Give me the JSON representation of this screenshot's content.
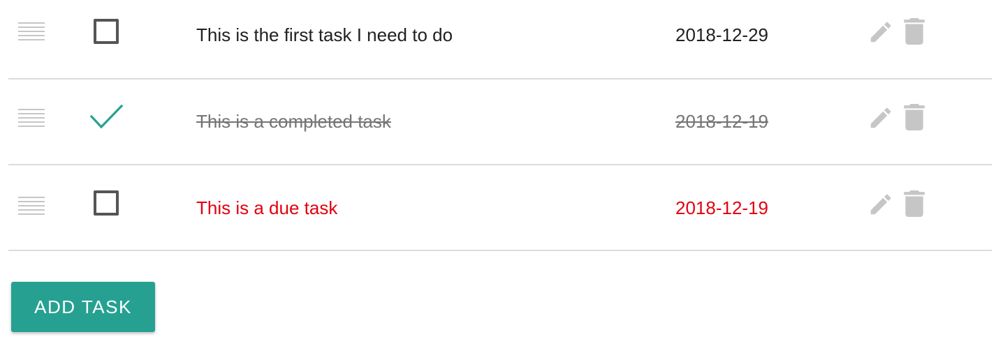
{
  "colors": {
    "accent": "#26a191",
    "due": "#e3000f",
    "completed": "#757575",
    "icon": "#c6c6c6"
  },
  "tasks": [
    {
      "title": "This is the first task I need to do",
      "date": "2018-12-29",
      "status": "open",
      "checked": false,
      "drag_icon": "drag-handle-icon",
      "edit_icon": "pencil-icon",
      "delete_icon": "trash-icon"
    },
    {
      "title": "This is a completed task",
      "date": "2018-12-19",
      "status": "completed",
      "checked": true,
      "drag_icon": "drag-handle-icon",
      "edit_icon": "pencil-icon",
      "delete_icon": "trash-icon"
    },
    {
      "title": "This is a due task",
      "date": "2018-12-19",
      "status": "due",
      "checked": false,
      "drag_icon": "drag-handle-icon",
      "edit_icon": "pencil-icon",
      "delete_icon": "trash-icon"
    }
  ],
  "add_button_label": "ADD TASK"
}
